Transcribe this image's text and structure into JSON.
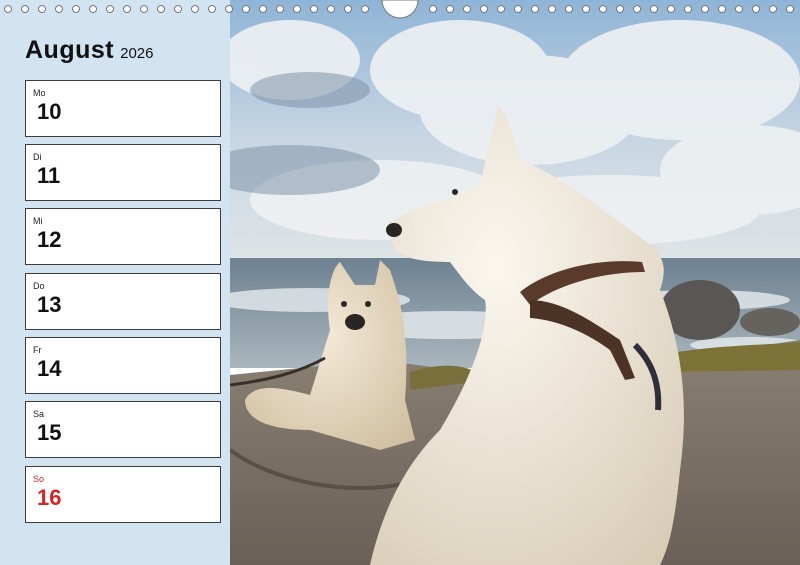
{
  "header": {
    "month": "August",
    "year": "2026"
  },
  "days": [
    {
      "name": "Mo",
      "num": "10"
    },
    {
      "name": "Di",
      "num": "11"
    },
    {
      "name": "Mi",
      "num": "12"
    },
    {
      "name": "Do",
      "num": "13"
    },
    {
      "name": "Fr",
      "num": "14"
    },
    {
      "name": "Sa",
      "num": "15"
    },
    {
      "name": "So",
      "num": "16"
    }
  ],
  "colors": {
    "sidebar": "#d2e3f1",
    "sunday": "#d0262a"
  },
  "photo": {
    "subject": "two-white-shepherd-dogs-on-beach"
  }
}
